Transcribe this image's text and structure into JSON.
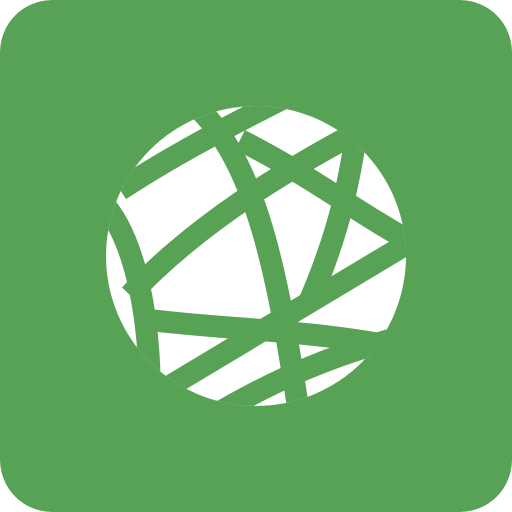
{
  "app_icon": {
    "icon": "globe-icon",
    "colors": {
      "background": "#58a255",
      "globe": "#ffffff",
      "grid_lines": "#58a255"
    }
  }
}
